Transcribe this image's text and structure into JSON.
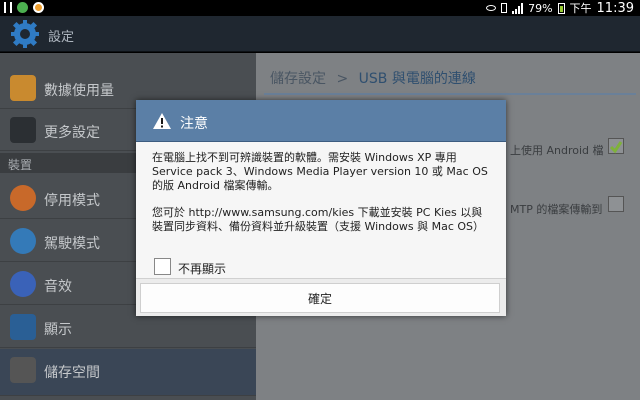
{
  "status_bar": {
    "battery": "79%",
    "time_period": "下午",
    "time": "11:39",
    "icons": [
      "usb-icon",
      "line-app-icon",
      "chrome-icon",
      "eye-icon",
      "vibrate-icon",
      "signal-icon",
      "battery-icon"
    ]
  },
  "action_bar": {
    "title": "設定",
    "icon": "settings-gear-icon"
  },
  "sidebar": {
    "items": [
      {
        "label": "數據使用量",
        "icon": "data-usage-icon",
        "color": "#e9a23b"
      },
      {
        "label": "更多設定",
        "icon": "more-settings-icon",
        "color": "#2b2f33"
      },
      {
        "label": "停用模式",
        "icon": "blocking-mode-icon",
        "color": "#e57c2f"
      },
      {
        "label": "駕駛模式",
        "icon": "driving-mode-icon",
        "color": "#3b8fd6"
      },
      {
        "label": "音效",
        "icon": "sound-icon",
        "color": "#3b6fd6"
      },
      {
        "label": "顯示",
        "icon": "display-icon",
        "color": "#2b6fb0"
      },
      {
        "label": "儲存空間",
        "icon": "storage-icon",
        "color": "#555"
      }
    ],
    "section_header": "裝置"
  },
  "content": {
    "breadcrumb_parent": "儲存設定",
    "breadcrumb_separator": ">",
    "breadcrumb_current": "USB 與電腦的連線",
    "row1_text": "上使用 Android 檔",
    "row2_text": "MTP 的檔案傳輸到"
  },
  "dialog": {
    "title": "注意",
    "message_1": "在電腦上找不到可辨識裝置的軟體。需安裝 Windows XP 專用 Service pack 3、Windows Media Player version 10 或 Mac OS 的版 Android 檔案傳輸。",
    "message_2": "您可於 http://www.samsung.com/kies 下載並安裝 PC Kies 以與裝置同步資料、備份資料並升級裝置（支援 Windows 與 Mac OS）",
    "checkbox_label": "不再顯示",
    "confirm_label": "確定"
  },
  "colors": {
    "dialog_header": "#5b7fa6",
    "action_bar": "#1f2730",
    "checkbox_checked": "#7fb23a"
  }
}
